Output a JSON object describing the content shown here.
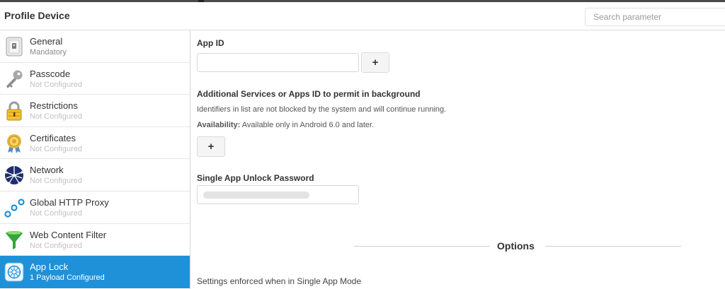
{
  "header": {
    "title": "Profile Device",
    "search_placeholder": "Search parameter"
  },
  "sidebar": {
    "items": [
      {
        "name": "General",
        "status": "Mandatory",
        "icon": "general-profile-icon"
      },
      {
        "name": "Passcode",
        "status": "Not Configured",
        "icon": "key-icon"
      },
      {
        "name": "Restrictions",
        "status": "Not Configured",
        "icon": "padlock-icon"
      },
      {
        "name": "Certificates",
        "status": "Not Configured",
        "icon": "certificate-badge-icon"
      },
      {
        "name": "Network",
        "status": "Not Configured",
        "icon": "globe-network-icon"
      },
      {
        "name": "Global HTTP Proxy",
        "status": "Not Configured",
        "icon": "proxy-nodes-icon"
      },
      {
        "name": "Web Content Filter",
        "status": "Not Configured",
        "icon": "funnel-filter-icon"
      },
      {
        "name": "App Lock",
        "status": "1 Payload Configured",
        "icon": "app-lock-icon"
      }
    ],
    "active_index": 7
  },
  "main": {
    "app_id": {
      "label": "App ID",
      "value": "",
      "add_label": "+"
    },
    "additional_services": {
      "label": "Additional Services or Apps ID to permit in background",
      "description": "Identifiers in list are not blocked by the system and will continue running.",
      "availability_label": "Availability:",
      "availability_text": "Available only in Android 6.0 and later.",
      "add_label": "+"
    },
    "unlock_password": {
      "label": "Single App Unlock Password"
    },
    "options": {
      "title": "Options",
      "settings_text": "Settings enforced when in Single App Mode"
    }
  },
  "colors": {
    "accent": "#1f91d8",
    "muted_text": "#c2c2c2"
  }
}
